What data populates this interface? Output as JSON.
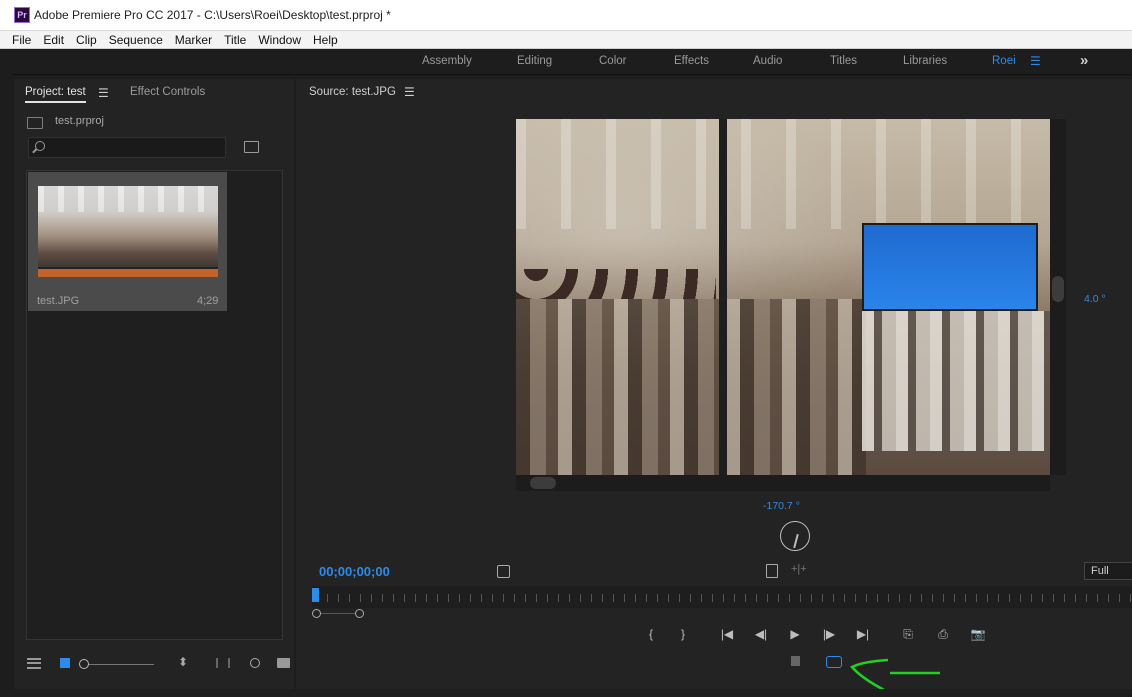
{
  "window": {
    "app_icon_text": "Pr",
    "title": "Adobe Premiere Pro CC 2017 - C:\\Users\\Roei\\Desktop\\test.prproj *"
  },
  "menu": [
    "File",
    "Edit",
    "Clip",
    "Sequence",
    "Marker",
    "Title",
    "Window",
    "Help"
  ],
  "workspaces": {
    "items": [
      "Assembly",
      "Editing",
      "Color",
      "Effects",
      "Audio",
      "Titles",
      "Libraries",
      "Roei"
    ],
    "active": "Roei",
    "menu_glyph": "☰",
    "more_glyph": "»"
  },
  "project_panel": {
    "tab_project": "Project: test",
    "tab_menu_glyph": "☰",
    "tab_effect_controls": "Effect Controls",
    "project_file": "test.prproj",
    "search_value": "",
    "clip": {
      "name": "test.JPG",
      "duration": "4;29"
    }
  },
  "source_monitor": {
    "title": "Source: test.JPG",
    "menu_glyph": "☰",
    "vr_vertical_angle": "4.0 °",
    "vr_horizontal_angle": "-170.7 °",
    "timecode": "00;00;00;00",
    "playback_resolution": "Full",
    "transport_glyphs": [
      "{",
      "}",
      "|◀",
      "◀|",
      "▶",
      "|▶",
      "▶|",
      "⎘",
      "⎙",
      "📷"
    ]
  },
  "colors": {
    "accent": "#2d8ceb",
    "panel_bg": "#232323",
    "app_bg": "#1d1d1d",
    "annotation": "#22d022"
  }
}
